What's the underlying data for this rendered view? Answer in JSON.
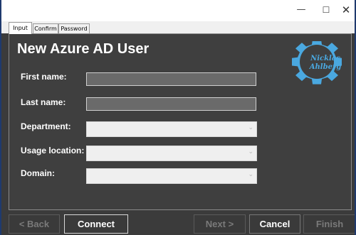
{
  "window": {
    "controls": {
      "minimize": "—",
      "maximize": "☐",
      "close": "✕"
    }
  },
  "tabs": [
    {
      "label": "Input",
      "active": true
    },
    {
      "label": "Confirm",
      "active": false
    },
    {
      "label": "Password",
      "active": false
    }
  ],
  "form": {
    "title": "New Azure AD User",
    "fields": {
      "first_name": {
        "label": "First name:",
        "value": ""
      },
      "last_name": {
        "label": "Last name:",
        "value": ""
      },
      "department": {
        "label": "Department:",
        "value": ""
      },
      "usage_location": {
        "label": "Usage location:",
        "value": ""
      },
      "domain": {
        "label": "Domain:",
        "value": ""
      }
    }
  },
  "logo": {
    "line1": "Nicklas",
    "line2": "Ahlberg",
    "icon": "gear-icon",
    "color": "#4aa8e0"
  },
  "buttons": {
    "back": "< Back",
    "connect": "Connect",
    "next": "Next >",
    "cancel": "Cancel",
    "finish": "Finish"
  }
}
